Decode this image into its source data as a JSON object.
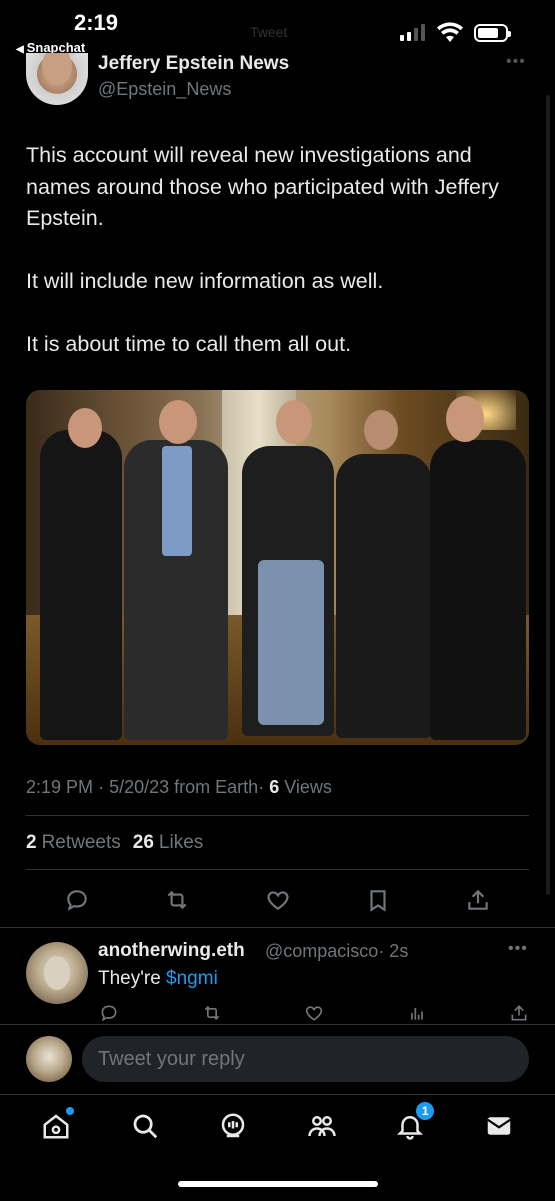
{
  "status_bar": {
    "time": "2:19",
    "back_app": "Snapchat"
  },
  "header_ghost": "Tweet",
  "tweet": {
    "author": {
      "display_name": "Jeffery Epstein News",
      "handle": "@Epstein_News"
    },
    "paragraphs": [
      "This account will reveal new investigations and names around those who participated with Jeffery Epstein.",
      "It will include new information as well.",
      "It is about time to call them all out."
    ],
    "image_alt": "Photo of five men standing in a room",
    "meta": {
      "time": "2:19 PM",
      "sep1": "·",
      "date": "5/20/23",
      "source": "from Earth",
      "sep2": "·",
      "views_count": "6",
      "views_label": "Views"
    },
    "stats": {
      "retweets_count": "2",
      "retweets_label": "Retweets",
      "likes_count": "26",
      "likes_label": "Likes"
    },
    "actions": [
      "reply-icon",
      "retweet-icon",
      "like-icon",
      "bookmark-icon",
      "share-icon"
    ]
  },
  "reply": {
    "display_name": "anotherwing.eth",
    "handle": "@compacisco",
    "time": "· 2s",
    "text_prefix": "They're ",
    "cashtag": "$ngmi",
    "actions": [
      "reply-icon",
      "retweet-icon",
      "like-icon",
      "analytics-icon",
      "share-icon"
    ]
  },
  "compose": {
    "placeholder": "Tweet your reply"
  },
  "tabs": [
    {
      "name": "home-icon",
      "indicator": true
    },
    {
      "name": "search-icon"
    },
    {
      "name": "spaces-icon"
    },
    {
      "name": "communities-icon"
    },
    {
      "name": "notifications-icon",
      "badge": "1"
    },
    {
      "name": "messages-icon"
    }
  ],
  "colors": {
    "accent": "#1d9bf0",
    "background": "#000000",
    "text": "#e7e9ea",
    "muted": "#71767b"
  }
}
